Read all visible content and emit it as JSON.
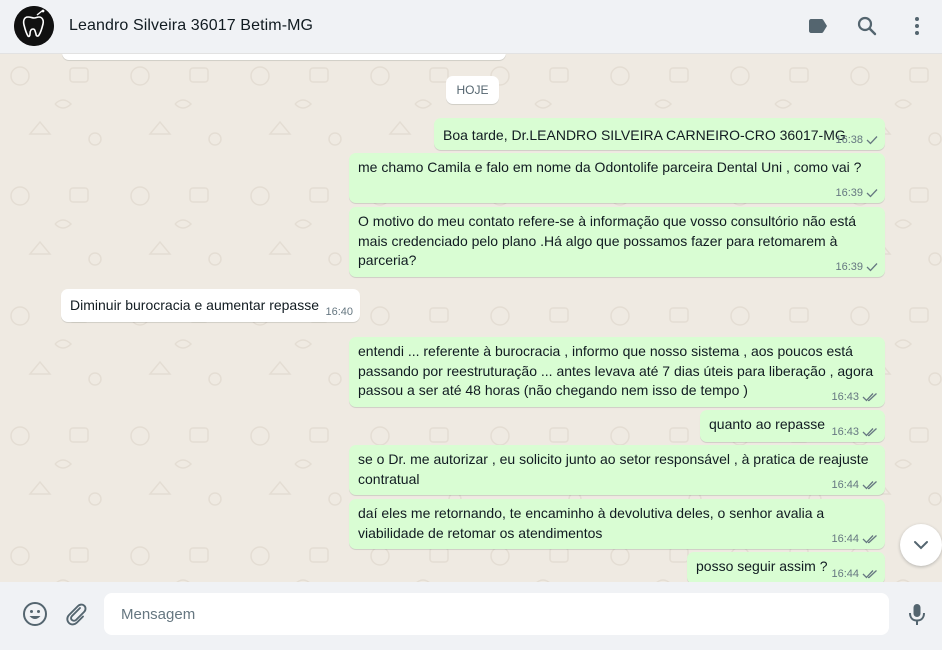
{
  "header": {
    "contact_name": "Leandro Silveira 36017 Betim-MG",
    "icons": [
      "label-icon",
      "search-icon",
      "menu-icon"
    ]
  },
  "chat": {
    "date_divider": "HOJE",
    "messages": [
      {
        "dir": "out",
        "text": "Boa tarde, Dr.LEANDRO SILVEIRA CARNEIRO-CRO 36017-MG",
        "time": "16:38",
        "status": "sent"
      },
      {
        "dir": "out",
        "text": "me chamo Camila e falo em nome da Odontolife parceira Dental Uni , como vai ?",
        "time": "16:39",
        "status": "sent"
      },
      {
        "dir": "out",
        "text": "O motivo do meu contato refere-se à informação que vosso consultório não está mais credenciado pelo plano .Há algo que possamos fazer para retomarem à parceria?",
        "time": "16:39",
        "status": "sent"
      },
      {
        "dir": "in",
        "text": "Diminuir burocracia e aumentar repasse",
        "time": "16:40"
      },
      {
        "dir": "out",
        "text": "entendi ... referente à burocracia , informo que nosso sistema , aos poucos está passando por reestruturação ... antes levava até 7 dias úteis para liberação , agora passou a ser até 48 horas (não chegando nem isso de tempo )",
        "time": "16:43",
        "status": "delivered"
      },
      {
        "dir": "out",
        "text": "quanto ao repasse",
        "time": "16:43",
        "status": "delivered"
      },
      {
        "dir": "out",
        "text": "se o Dr. me autorizar , eu solicito junto ao setor responsável , à pratica de reajuste contratual",
        "time": "16:44",
        "status": "delivered"
      },
      {
        "dir": "out",
        "text": "daí eles me retornando, te encaminho à devolutiva deles, o senhor avalia a viabilidade de retomar os atendimentos",
        "time": "16:44",
        "status": "delivered"
      },
      {
        "dir": "out",
        "text": "posso seguir assim ?",
        "time": "16:44",
        "status": "delivered"
      }
    ]
  },
  "footer": {
    "input_placeholder": "Mensagem",
    "input_value": "",
    "icons": [
      "emoji-icon",
      "attach-icon",
      "microphone-icon"
    ]
  },
  "colors": {
    "outgoing_bubble": "#d9fdd3",
    "incoming_bubble": "#ffffff",
    "chat_background": "#efeae2",
    "panel": "#f0f2f5"
  }
}
